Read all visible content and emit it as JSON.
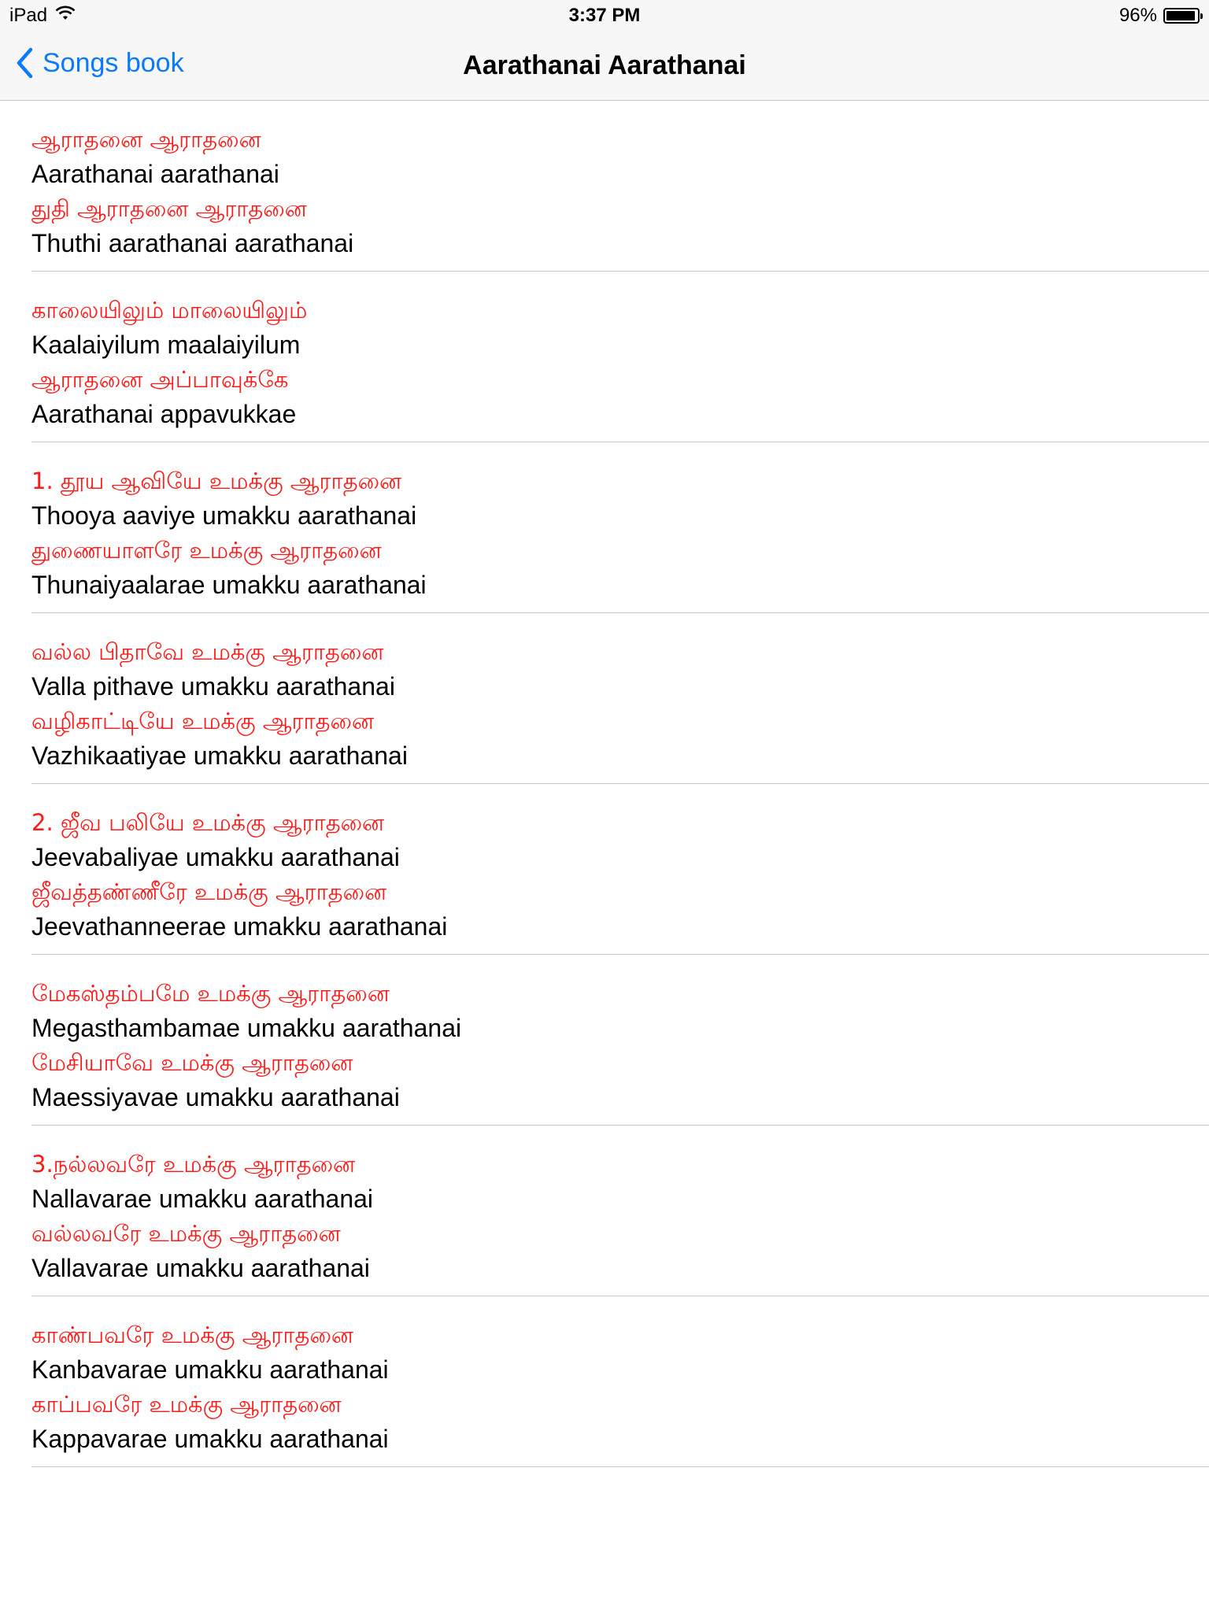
{
  "status_bar": {
    "device": "iPad",
    "time": "3:37 PM",
    "battery_percent": "96%",
    "battery_level": 0.96
  },
  "nav": {
    "back_label": "Songs book",
    "title": "Aarathanai Aarathanai"
  },
  "colors": {
    "tamil_text": "#ff1a1a",
    "accent": "#0a7aff"
  },
  "verses": [
    {
      "lines": [
        {
          "lang": "tamil",
          "text": "ஆராதனை ஆராதனை"
        },
        {
          "lang": "english",
          "text": "Aarathanai aarathanai"
        },
        {
          "lang": "tamil",
          "text": "துதி ஆராதனை ஆராதனை"
        },
        {
          "lang": "english",
          "text": "Thuthi aarathanai aarathanai"
        }
      ]
    },
    {
      "lines": [
        {
          "lang": "tamil",
          "text": "காலையிலும் மாலையிலும்"
        },
        {
          "lang": "english",
          "text": "Kaalaiyilum maalaiyilum"
        },
        {
          "lang": "tamil",
          "text": "ஆராதனை அப்பாவுக்கே"
        },
        {
          "lang": "english",
          "text": "Aarathanai appavukkae"
        }
      ]
    },
    {
      "lines": [
        {
          "lang": "tamil",
          "text": "1. தூய ஆவியே உமக்கு ஆராதனை"
        },
        {
          "lang": "english",
          "text": "Thooya aaviye umakku aarathanai"
        },
        {
          "lang": "tamil",
          "text": "துணையாளரே உமக்கு ஆராதனை"
        },
        {
          "lang": "english",
          "text": "Thunaiyaalarae umakku aarathanai"
        }
      ]
    },
    {
      "lines": [
        {
          "lang": "tamil",
          "text": "வல்ல பிதாவே உமக்கு ஆராதனை"
        },
        {
          "lang": "english",
          "text": "Valla pithave umakku aarathanai"
        },
        {
          "lang": "tamil",
          "text": "வழிகாட்டியே உமக்கு ஆராதனை"
        },
        {
          "lang": "english",
          "text": "Vazhikaatiyae umakku aarathanai"
        }
      ]
    },
    {
      "lines": [
        {
          "lang": "tamil",
          "text": "2. ஜீவ பலியே உமக்கு ஆராதனை"
        },
        {
          "lang": "english",
          "text": "Jeevabaliyae umakku aarathanai"
        },
        {
          "lang": "tamil",
          "text": "ஜீவத்தண்ணீரே உமக்கு ஆராதனை"
        },
        {
          "lang": "english",
          "text": "Jeevathanneerae umakku aarathanai"
        }
      ]
    },
    {
      "lines": [
        {
          "lang": "tamil",
          "text": "மேகஸ்தம்பமே உமக்கு ஆராதனை"
        },
        {
          "lang": "english",
          "text": "Megasthambamae umakku aarathanai"
        },
        {
          "lang": "tamil",
          "text": "மேசியாவே உமக்கு ஆராதனை"
        },
        {
          "lang": "english",
          "text": "Maessiyavae umakku aarathanai"
        }
      ]
    },
    {
      "lines": [
        {
          "lang": "tamil",
          "text": "3.நல்லவரே உமக்கு ஆராதனை"
        },
        {
          "lang": "english",
          "text": "Nallavarae umakku aarathanai"
        },
        {
          "lang": "tamil",
          "text": "வல்லவரே உமக்கு ஆராதனை"
        },
        {
          "lang": "english",
          "text": "Vallavarae umakku aarathanai"
        }
      ]
    },
    {
      "lines": [
        {
          "lang": "tamil",
          "text": "காண்பவரே உமக்கு ஆராதனை"
        },
        {
          "lang": "english",
          "text": "Kanbavarae umakku aarathanai"
        },
        {
          "lang": "tamil",
          "text": "காப்பவரே உமக்கு ஆராதனை"
        },
        {
          "lang": "english",
          "text": "Kappavarae umakku aarathanai"
        }
      ]
    }
  ]
}
